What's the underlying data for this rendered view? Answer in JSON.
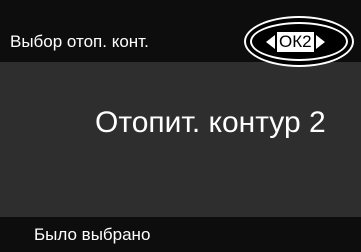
{
  "header": {
    "title": "Выбор отоп. конт."
  },
  "selector": {
    "value": "ОК2",
    "left_arrow_icon": "triangle-left-icon",
    "right_arrow_icon": "triangle-right-icon"
  },
  "main": {
    "text": "Отопит. контур 2"
  },
  "footer": {
    "status": "Было выбрано"
  },
  "colors": {
    "header_bg": "#0d0d0d",
    "body_bg": "#2e2e2e",
    "text": "#ffffff",
    "selector_bg": "#ffffff",
    "selector_text": "#000000"
  }
}
